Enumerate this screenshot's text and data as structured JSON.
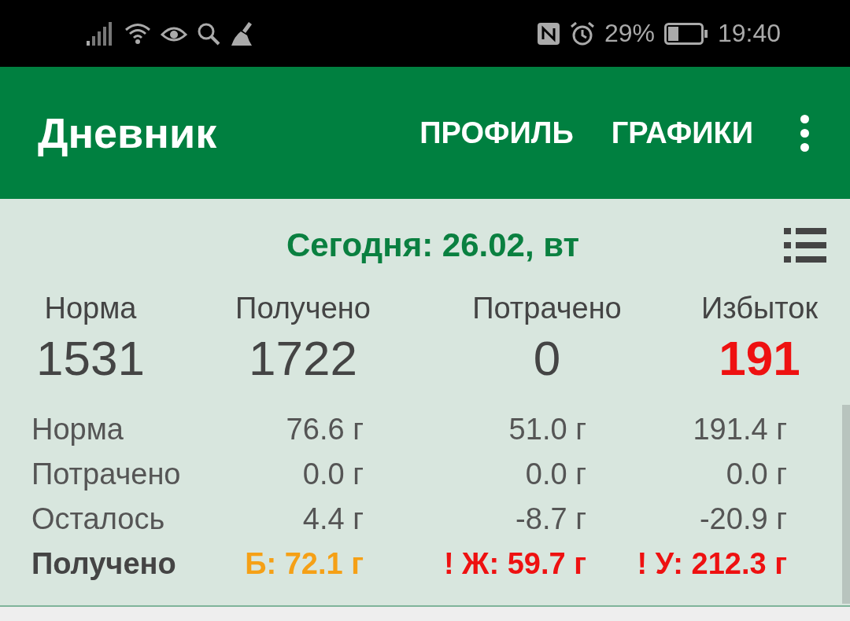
{
  "status_bar": {
    "battery": "29%",
    "time": "19:40"
  },
  "app_bar": {
    "title": "Дневник",
    "actions": [
      "ПРОФИЛЬ",
      "ГРАФИКИ"
    ]
  },
  "date_label": "Сегодня: 26.02, вт",
  "summary": [
    {
      "label": "Норма",
      "value": "1531",
      "alert": false
    },
    {
      "label": "Получено",
      "value": "1722",
      "alert": false
    },
    {
      "label": "Потрачено",
      "value": "0",
      "alert": false
    },
    {
      "label": "Избыток",
      "value": "191",
      "alert": true
    }
  ],
  "macros": [
    {
      "label": "Норма",
      "values": [
        "76.6 г",
        "51.0 г",
        "191.4 г"
      ]
    },
    {
      "label": "Потрачено",
      "values": [
        "0.0 г",
        "0.0 г",
        "0.0 г"
      ]
    },
    {
      "label": "Осталось",
      "values": [
        "4.4 г",
        "-8.7 г",
        "-20.9 г"
      ]
    }
  ],
  "totals": {
    "label": "Получено",
    "values": [
      {
        "text": "Б: 72.1 г",
        "color": "#f5a016"
      },
      {
        "text": "! Ж: 59.7 г",
        "color": "#ee1111"
      },
      {
        "text": "! У: 212.3 г",
        "color": "#ee1111"
      }
    ]
  }
}
